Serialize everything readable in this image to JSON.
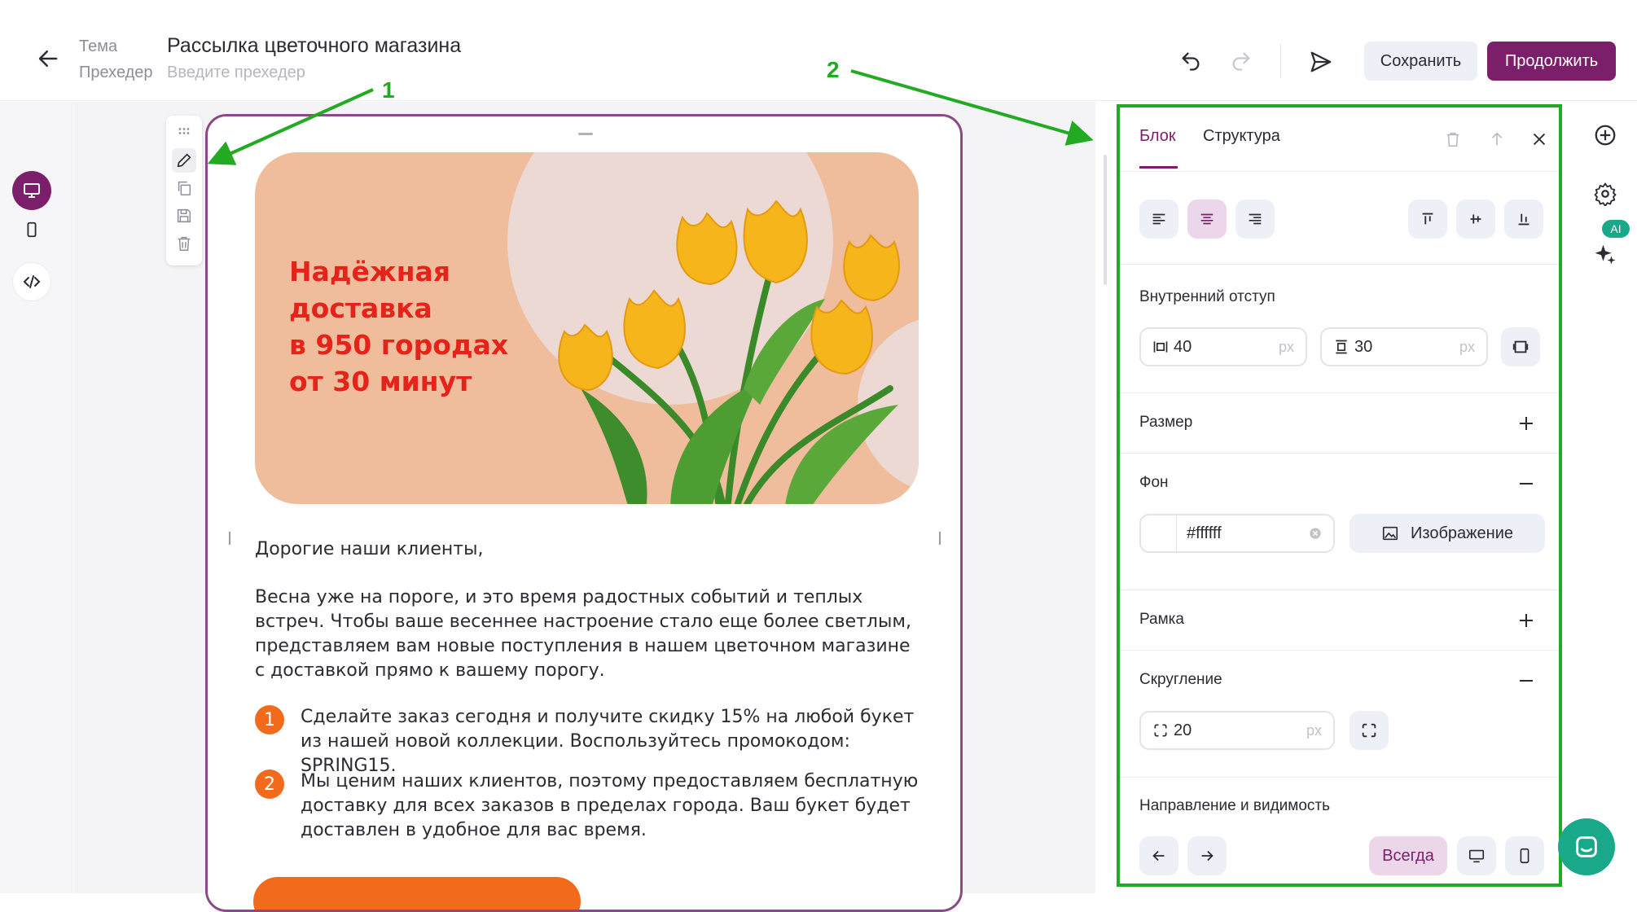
{
  "header": {
    "theme_label": "Тема",
    "theme_value": "Рассылка цветочного магазина",
    "preheader_label": "Прехедер",
    "preheader_placeholder": "Введите прехедер",
    "save_label": "Сохранить",
    "continue_label": "Продолжить"
  },
  "annotations": {
    "a1": "1",
    "a2": "2"
  },
  "email": {
    "banner_lines": [
      "Надёжная",
      "доставка",
      "в 950 городах",
      "от 30 минут"
    ],
    "greeting": "Дорогие наши клиенты,",
    "paragraph": "Весна уже на пороге, и это время радостных событий и теплых встреч. Чтобы ваше весеннее настроение стало еще более светлым, представляем вам новые поступления в нашем цветочном магазине с доставкой прямо к вашему порогу.",
    "items": [
      {
        "num": "1",
        "text": "Сделайте заказ сегодня и получите скидку 15% на любой букет из нашей новой коллекции. Воспользуйтесь промокодом: SPRING15."
      },
      {
        "num": "2",
        "text": "Мы ценим наших клиентов, поэтому предоставляем бесплатную доставку для всех заказов в пределах города. Ваш букет будет доставлен в удобное для вас время."
      }
    ]
  },
  "panel": {
    "tabs": [
      "Блок",
      "Структура"
    ],
    "padding_title": "Внутренний отступ",
    "padding_h": "40",
    "padding_v": "30",
    "unit": "px",
    "size_title": "Размер",
    "bg_title": "Фон",
    "bg_color": "#ffffff",
    "image_label": "Изображение",
    "border_title": "Рамка",
    "radius_title": "Скругление",
    "radius_value": "20",
    "direction_title": "Направление и видимость",
    "always_label": "Всегда"
  },
  "rightbar": {
    "ai_badge": "AI"
  },
  "colors": {
    "accent": "#7b1f6b",
    "annotation": "#22aa22",
    "orange": "#f26a1b",
    "banner": "#efbc9c",
    "headline": "#e5231b"
  }
}
